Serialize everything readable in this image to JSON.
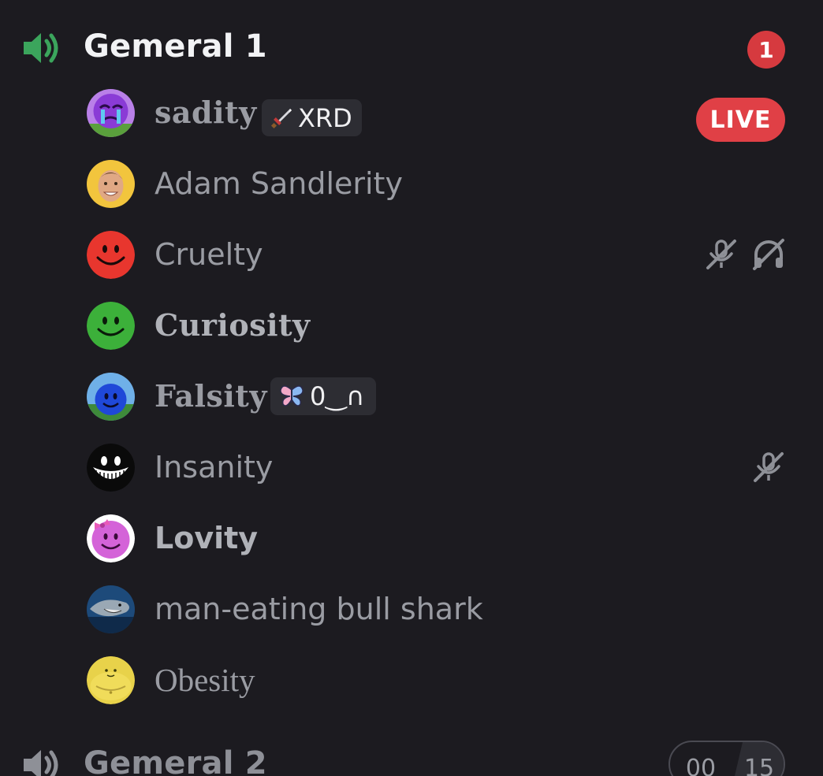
{
  "colors": {
    "background": "#1c1b20",
    "speaker_active": "#3ba55c",
    "speaker_inactive": "#8e9097",
    "live": "#e04046",
    "unread": "#d63a3f"
  },
  "channels": [
    {
      "name": "Gemeral 1",
      "icon": "speaker-icon",
      "unread_count": "1",
      "members": [
        {
          "name": "sadity",
          "tag": "XRD",
          "tag_emoji": "sword-icon",
          "live": "LIVE"
        },
        {
          "name": "Adam Sandlerity"
        },
        {
          "name": "Cruelty",
          "muted": true,
          "deafened": true
        },
        {
          "name": "Curiosity"
        },
        {
          "name": "Falsity",
          "tag": "0‿∩",
          "tag_emoji": "butterfly-icon"
        },
        {
          "name": "Insanity",
          "muted": true
        },
        {
          "name": "Lovity"
        },
        {
          "name": "man-eating bull shark"
        },
        {
          "name": "Obesity"
        }
      ]
    },
    {
      "name": "Gemeral 2",
      "icon": "speaker-icon",
      "user_count": "00",
      "user_limit": "15"
    }
  ]
}
